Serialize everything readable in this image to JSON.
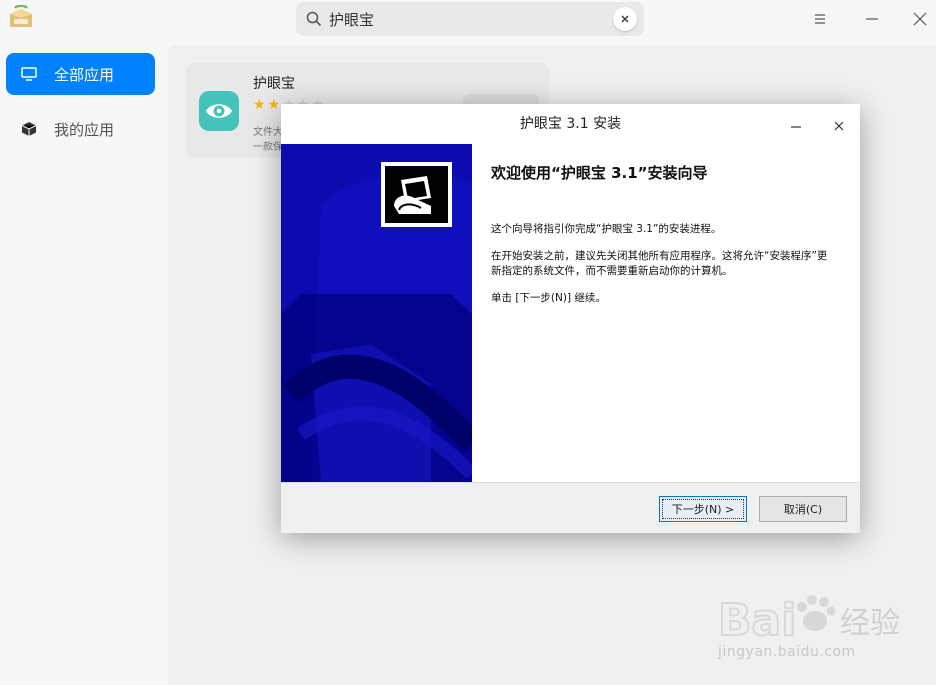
{
  "titlebar": {
    "logo_text": "UOS",
    "search": {
      "value": "护眼宝",
      "icon": "search-icon",
      "clear_icon": "clear-icon"
    },
    "controls": {
      "menu": "menu-icon",
      "minimize": "minimize-icon",
      "close": "close-icon"
    }
  },
  "sidebar": {
    "items": [
      {
        "label": "全部应用",
        "icon": "monitor-icon",
        "active": true
      },
      {
        "label": "我的应用",
        "icon": "cube-icon",
        "active": false
      }
    ]
  },
  "app_card": {
    "name": "护眼宝",
    "rating": 2,
    "rating_max": 5,
    "desc_line1": "文件大",
    "desc_line2": "一款保"
  },
  "installer": {
    "title": "护眼宝 3.1 安装",
    "heading": "欢迎使用“护眼宝 3.1”安装向导",
    "para1": "这个向导将指引你完成“护眼宝 3.1”的安装进程。",
    "para2": "在开始安装之前，建议先关闭其他所有应用程序。这将允许“安装程序”更新指定的系统文件，而不需要重新启动你的计算机。",
    "para3": "单击 [下一步(N)] 继续。",
    "next_label": "下一步(N) >",
    "cancel_label": "取消(C)",
    "banner_color": "#0b0bb0"
  },
  "watermark": {
    "brand": "Bai 经验",
    "url": "jingyan.baidu.com"
  },
  "colors": {
    "accent": "#0081ff",
    "star": "#f3b800",
    "app_icon": "#43c3bb"
  }
}
